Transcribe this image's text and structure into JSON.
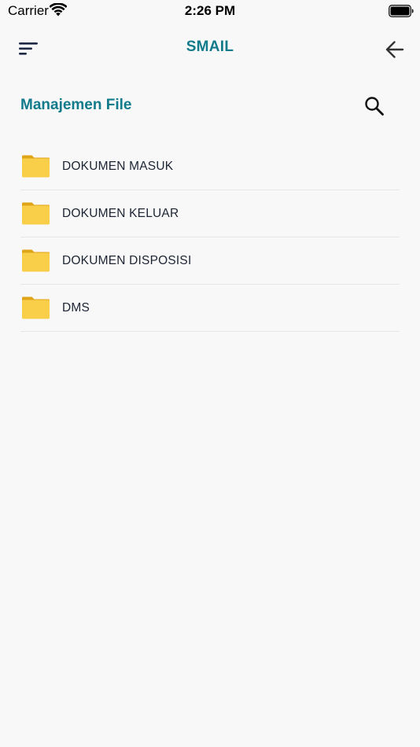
{
  "status_bar": {
    "carrier": "Carrier",
    "time": "2:26 PM",
    "icons": [
      "wifi-icon",
      "battery-icon"
    ]
  },
  "header": {
    "title": "SMAIL",
    "left_icon": "menu-icon",
    "right_icon": "back-arrow-icon"
  },
  "section": {
    "title": "Manajemen File",
    "action_icon": "search-icon"
  },
  "files": [
    {
      "label": "DOKUMEN MASUK",
      "icon": "folder-icon"
    },
    {
      "label": "DOKUMEN KELUAR",
      "icon": "folder-icon"
    },
    {
      "label": "DOKUMEN DISPOSISI",
      "icon": "folder-icon"
    },
    {
      "label": "DMS",
      "icon": "folder-icon"
    }
  ],
  "colors": {
    "accent": "#117a8b",
    "background": "#f8f8f8",
    "folder": "#f9cf4a",
    "folder_tab": "#e0a419",
    "divider": "#e6e6e6"
  }
}
